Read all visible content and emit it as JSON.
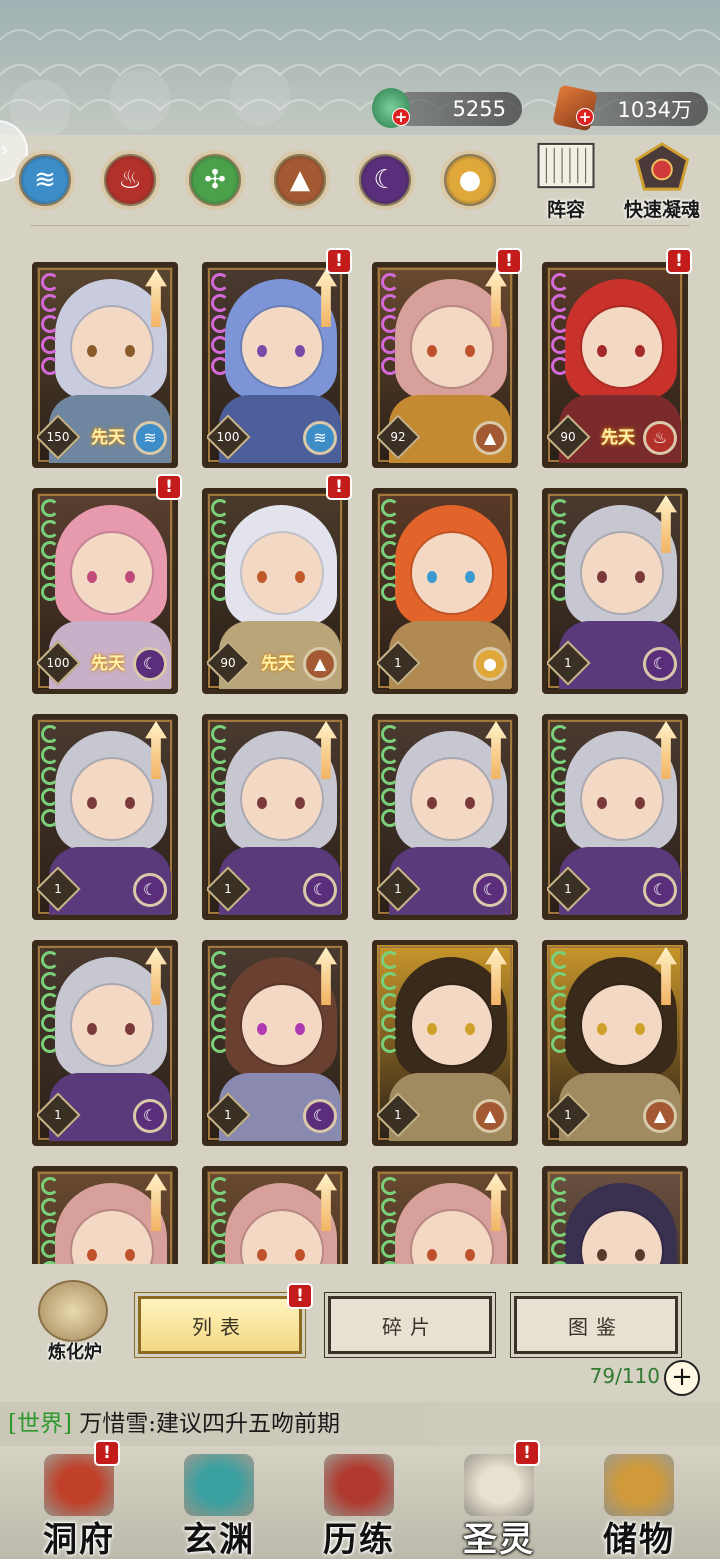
{
  "currency": {
    "jade": "5255",
    "gold": "1034万"
  },
  "elements": [
    {
      "name": "water-element-icon",
      "color": "#3d8ec8",
      "glyph": "≋"
    },
    {
      "name": "fire-element-icon",
      "color": "#b3312a",
      "glyph": "♨"
    },
    {
      "name": "wood-element-icon",
      "color": "#4aa14a",
      "glyph": "✣"
    },
    {
      "name": "earth-element-icon",
      "color": "#a35a32",
      "glyph": "▲"
    },
    {
      "name": "dark-element-icon",
      "color": "#5a2e7a",
      "glyph": "☾"
    },
    {
      "name": "light-element-icon",
      "color": "#e0a83a",
      "glyph": "●"
    }
  ],
  "top_buttons": {
    "lineup": "阵容",
    "quick_soul": "快速凝魂"
  },
  "cards": [
    {
      "level": "150",
      "innate": "先天",
      "attr": "water",
      "alert": false,
      "arrow": true,
      "hair": "#c9ccdf",
      "eye": "#8a5a2a",
      "body": "#6f86a0",
      "bg": "#5a4530",
      "star": "#d46ad8"
    },
    {
      "level": "100",
      "innate": "",
      "attr": "water",
      "alert": true,
      "arrow": true,
      "hair": "#7d95d6",
      "eye": "#7a4aa8",
      "body": "#4c5f9a",
      "bg": "#4a3a30",
      "star": "#d46ad8"
    },
    {
      "level": "92",
      "innate": "",
      "attr": "earth",
      "alert": true,
      "arrow": true,
      "hair": "#d7a09a",
      "eye": "#c0502a",
      "body": "#c48a32",
      "bg": "#6a4a30",
      "star": "#d46ad8"
    },
    {
      "level": "90",
      "innate": "先天",
      "attr": "fire",
      "alert": true,
      "arrow": false,
      "hair": "#c8322a",
      "eye": "#a32a2a",
      "body": "#7a2a2a",
      "bg": "#5a3a28",
      "star": "#d46ad8"
    },
    {
      "level": "100",
      "innate": "先天",
      "attr": "dark",
      "alert": true,
      "arrow": false,
      "hair": "#e79aae",
      "eye": "#c04a7a",
      "body": "#c8b0c8",
      "bg": "#5a4030",
      "star": "#7ad07a"
    },
    {
      "level": "90",
      "innate": "先天",
      "attr": "earth",
      "alert": true,
      "arrow": false,
      "hair": "#e3e3ee",
      "eye": "#c05a2a",
      "body": "#b9a57a",
      "bg": "#4a3a2a",
      "star": "#7ad07a"
    },
    {
      "level": "1",
      "innate": "",
      "attr": "light",
      "alert": false,
      "arrow": false,
      "hair": "#e2642a",
      "eye": "#3a9ad0",
      "body": "#b08a52",
      "bg": "#5a3a28",
      "star": "#7ad07a"
    },
    {
      "level": "1",
      "innate": "",
      "attr": "dark",
      "alert": false,
      "arrow": true,
      "hair": "#c7c7d2",
      "eye": "#7a3a3a",
      "body": "#5a3a7a",
      "bg": "#4a3a30",
      "star": "#7ad07a"
    },
    {
      "level": "1",
      "innate": "",
      "attr": "dark",
      "alert": false,
      "arrow": true,
      "hair": "#c7c7d2",
      "eye": "#7a3a3a",
      "body": "#5a3a7a",
      "bg": "#4a3a30",
      "star": "#7ad07a"
    },
    {
      "level": "1",
      "innate": "",
      "attr": "dark",
      "alert": false,
      "arrow": true,
      "hair": "#c7c7d2",
      "eye": "#7a3a3a",
      "body": "#5a3a7a",
      "bg": "#4a3a30",
      "star": "#7ad07a"
    },
    {
      "level": "1",
      "innate": "",
      "attr": "dark",
      "alert": false,
      "arrow": true,
      "hair": "#c7c7d2",
      "eye": "#7a3a3a",
      "body": "#5a3a7a",
      "bg": "#4a3a30",
      "star": "#7ad07a"
    },
    {
      "level": "1",
      "innate": "",
      "attr": "dark",
      "alert": false,
      "arrow": true,
      "hair": "#c7c7d2",
      "eye": "#7a3a3a",
      "body": "#5a3a7a",
      "bg": "#4a3a30",
      "star": "#7ad07a"
    },
    {
      "level": "1",
      "innate": "",
      "attr": "dark",
      "alert": false,
      "arrow": true,
      "hair": "#c7c7d2",
      "eye": "#7a3a3a",
      "body": "#5a3a7a",
      "bg": "#4a3a30",
      "star": "#7ad07a"
    },
    {
      "level": "1",
      "innate": "",
      "attr": "dark",
      "alert": false,
      "arrow": true,
      "hair": "#6a4030",
      "eye": "#b03ab0",
      "body": "#8a8ab0",
      "bg": "#4a3a30",
      "star": "#7ad07a"
    },
    {
      "level": "1",
      "innate": "",
      "attr": "earth",
      "alert": false,
      "arrow": true,
      "hair": "#3a2a1a",
      "eye": "#d0a02a",
      "body": "#a08a60",
      "bg": "#c8962a",
      "star": "#7ad07a"
    },
    {
      "level": "1",
      "innate": "",
      "attr": "earth",
      "alert": false,
      "arrow": true,
      "hair": "#3a2a1a",
      "eye": "#d0a02a",
      "body": "#a08a60",
      "bg": "#c8962a",
      "star": "#7ad07a"
    },
    {
      "level": "",
      "innate": "",
      "attr": "",
      "alert": false,
      "arrow": true,
      "hair": "#d7a09a",
      "eye": "#c0502a",
      "body": "#c48a32",
      "bg": "#6a4a30",
      "star": "#7ad07a"
    },
    {
      "level": "",
      "innate": "",
      "attr": "",
      "alert": false,
      "arrow": true,
      "hair": "#d7a09a",
      "eye": "#c0502a",
      "body": "#c48a32",
      "bg": "#6a4a30",
      "star": "#7ad07a"
    },
    {
      "level": "",
      "innate": "",
      "attr": "",
      "alert": false,
      "arrow": true,
      "hair": "#d7a09a",
      "eye": "#c0502a",
      "body": "#c48a32",
      "bg": "#6a4a30",
      "star": "#7ad07a"
    },
    {
      "level": "",
      "innate": "",
      "attr": "",
      "alert": false,
      "arrow": false,
      "hair": "#3a3050",
      "eye": "#5a3a2a",
      "body": "#5a4a6a",
      "bg": "#6a5040",
      "star": "#7ad07a"
    }
  ],
  "attr_colors": {
    "water": "#3d8ec8",
    "fire": "#b3312a",
    "earth": "#a35a32",
    "dark": "#5a2e7a",
    "light": "#e0a83a"
  },
  "furnace": "炼化炉",
  "tabs": {
    "list": "列表",
    "fragments": "碎片",
    "atlas": "图鉴"
  },
  "capacity": "79/110",
  "chat": {
    "channel": "[世界]",
    "message": "万惜雪:建议四升五吻前期"
  },
  "nav": [
    {
      "label": "洞府",
      "icon": "palace-icon",
      "color": "#c0402a",
      "alert": true,
      "active": false
    },
    {
      "label": "玄渊",
      "icon": "abyss-icon",
      "color": "#3aa0a0",
      "alert": false,
      "active": false
    },
    {
      "label": "历练",
      "icon": "sword-icon",
      "color": "#b03a30",
      "alert": false,
      "active": false
    },
    {
      "label": "圣灵",
      "icon": "tiger-icon",
      "color": "#e8e0d0",
      "alert": true,
      "active": true
    },
    {
      "label": "储物",
      "icon": "bag-icon",
      "color": "#d09a3a",
      "alert": false,
      "active": false
    }
  ]
}
